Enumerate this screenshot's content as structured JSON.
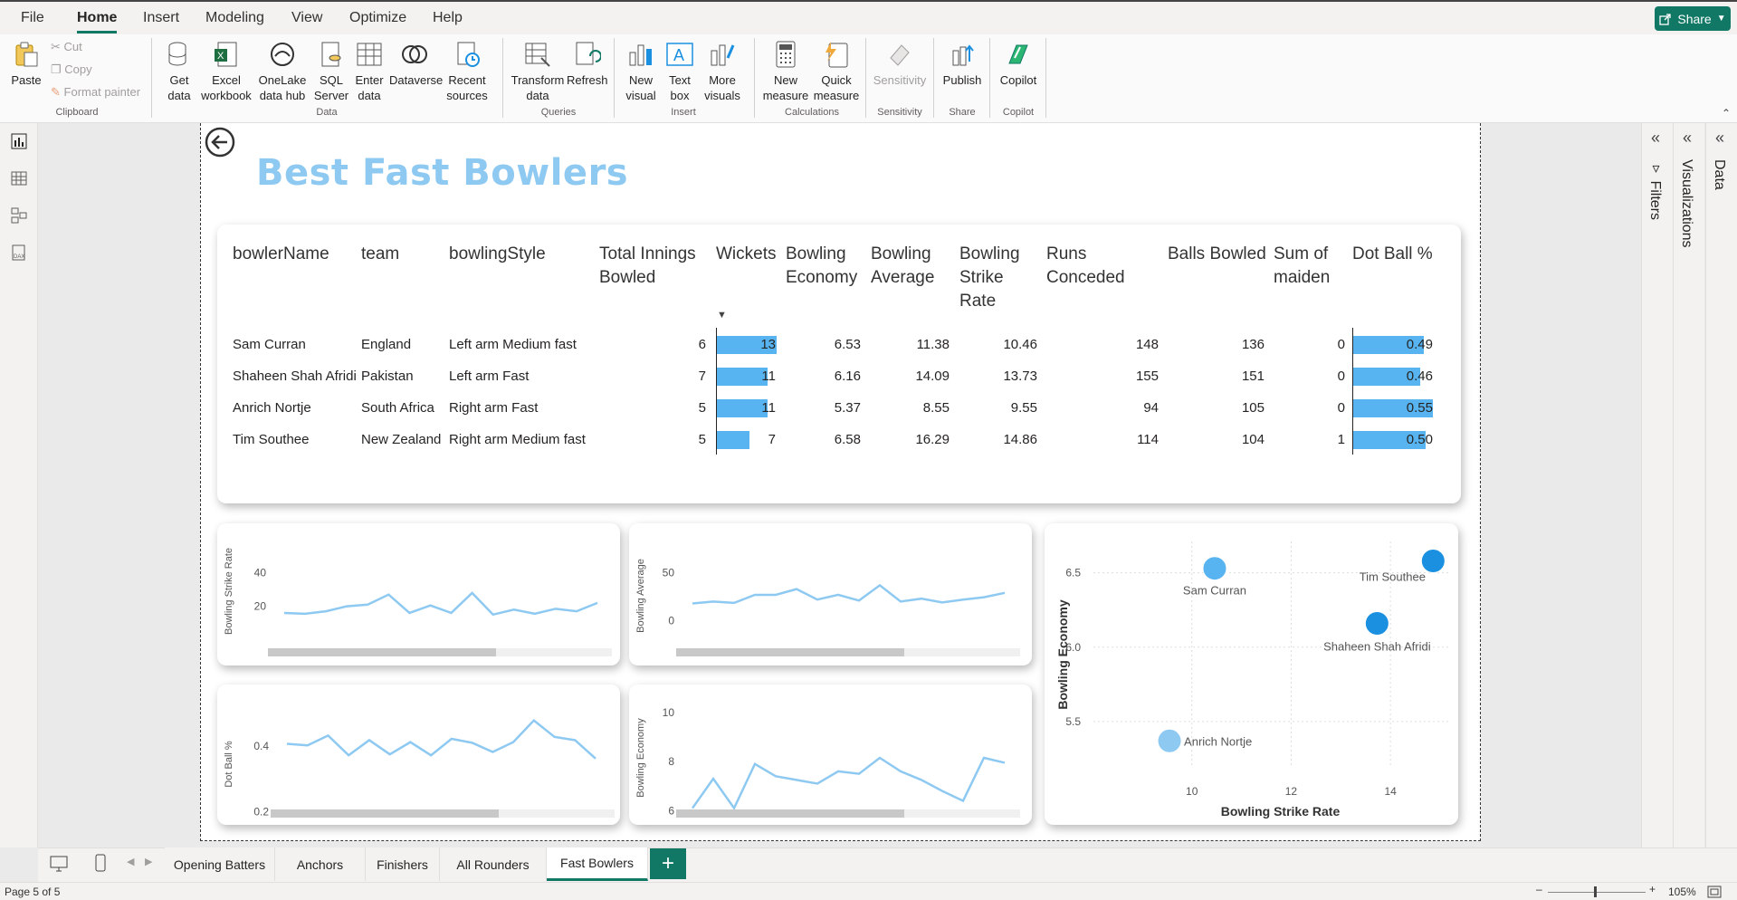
{
  "menu": {
    "items": [
      "File",
      "Home",
      "Insert",
      "Modeling",
      "View",
      "Optimize",
      "Help"
    ],
    "active": "Home",
    "share": "Share"
  },
  "ribbon": {
    "paste": "Paste",
    "cut": "Cut",
    "copy": "Copy",
    "format_painter": "Format painter",
    "get_data": "Get data",
    "excel": "Excel workbook",
    "onelake": "OneLake data hub",
    "sql": "SQL Server",
    "enter_data": "Enter data",
    "dataverse": "Dataverse",
    "recent": "Recent sources",
    "transform": "Transform data",
    "refresh": "Refresh",
    "new_visual": "New visual",
    "text_box": "Text box",
    "more_visuals": "More visuals",
    "new_measure": "New measure",
    "quick_measure": "Quick measure",
    "sensitivity": "Sensitivity",
    "publish": "Publish",
    "copilot": "Copilot",
    "groups": {
      "clipboard": "Clipboard",
      "data": "Data",
      "queries": "Queries",
      "insert": "Insert",
      "calculations": "Calculations",
      "sensitivity": "Sensitivity",
      "share": "Share",
      "copilot": "Copilot"
    }
  },
  "report": {
    "title": "Best Fast Bowlers",
    "table": {
      "columns": [
        "bowlerName",
        "team",
        "bowlingStyle",
        "Total Innings Bowled",
        "Wickets",
        "Bowling Economy",
        "Bowling Average",
        "Bowling Strike Rate",
        "Runs Conceded",
        "Balls Bowled",
        "Sum of maiden",
        "Dot Ball %"
      ],
      "rows": [
        {
          "name": "Sam Curran",
          "team": "England",
          "style": "Left arm Medium fast",
          "innings": "6",
          "wickets": "13",
          "economy": "6.53",
          "average": "11.38",
          "strike": "10.46",
          "runs": "148",
          "balls": "136",
          "maiden": "0",
          "dot": "0.49"
        },
        {
          "name": "Shaheen Shah Afridi",
          "team": "Pakistan",
          "style": "Left arm Fast",
          "innings": "7",
          "wickets": "11",
          "economy": "6.16",
          "average": "14.09",
          "strike": "13.73",
          "runs": "155",
          "balls": "151",
          "maiden": "0",
          "dot": "0.46"
        },
        {
          "name": "Anrich Nortje",
          "team": "South Africa",
          "style": "Right arm Fast",
          "innings": "5",
          "wickets": "11",
          "economy": "5.37",
          "average": "8.55",
          "strike": "9.55",
          "runs": "94",
          "balls": "105",
          "maiden": "0",
          "dot": "0.55"
        },
        {
          "name": "Tim Southee",
          "team": "New Zealand",
          "style": "Right arm Medium fast",
          "innings": "5",
          "wickets": "7",
          "economy": "6.58",
          "average": "16.29",
          "strike": "14.86",
          "runs": "114",
          "balls": "104",
          "maiden": "1",
          "dot": "0.50"
        }
      ]
    }
  },
  "chart_data": [
    {
      "type": "line",
      "ylabel": "Bowling Strike Rate",
      "yticks": [
        20,
        40
      ],
      "ylim": [
        10,
        48
      ],
      "series": [
        {
          "values": [
            16,
            15.5,
            17,
            20,
            21,
            27,
            16,
            20.5,
            16,
            28,
            15,
            18,
            15.5,
            18.5,
            17,
            22
          ]
        }
      ]
    },
    {
      "type": "line",
      "ylabel": "Bowling Average",
      "yticks": [
        0,
        50
      ],
      "ylim": [
        -10,
        62
      ],
      "series": [
        {
          "values": [
            18,
            20,
            18.5,
            27,
            27,
            33,
            22,
            27,
            21,
            37,
            20,
            23,
            19,
            22,
            24.5,
            29
          ]
        }
      ]
    },
    {
      "type": "line",
      "ylabel": "Dot Ball %",
      "yticks": [
        0.2,
        0.4
      ],
      "ylim": [
        0.18,
        0.51
      ],
      "series": [
        {
          "values": [
            0.407,
            0.402,
            0.432,
            0.372,
            0.418,
            0.375,
            0.412,
            0.372,
            0.422,
            0.41,
            0.382,
            0.412,
            0.478,
            0.428,
            0.418,
            0.362
          ]
        }
      ]
    },
    {
      "type": "line",
      "ylabel": "Bowling Economy",
      "yticks": [
        6,
        8,
        10
      ],
      "ylim": [
        5.9,
        10.4
      ],
      "series": [
        {
          "values": [
            6.1,
            7.3,
            6.1,
            7.9,
            7.4,
            7.25,
            7.1,
            7.6,
            7.5,
            8.15,
            7.6,
            7.25,
            6.8,
            6.4,
            8.15,
            7.95
          ]
        }
      ]
    },
    {
      "type": "scatter",
      "xlabel": "Bowling Strike Rate",
      "ylabel": "Bowling Economy",
      "xticks": [
        10,
        12,
        14
      ],
      "yticks": [
        5.5,
        6.0,
        6.5
      ],
      "xlim": [
        8.2,
        15
      ],
      "ylim": [
        5.25,
        6.65
      ],
      "points": [
        {
          "label": "Sam Curran",
          "x": 10.46,
          "y": 6.53,
          "color": "#57b4f1"
        },
        {
          "label": "Tim Southee",
          "x": 14.86,
          "y": 6.58,
          "color": "#1b90e0"
        },
        {
          "label": "Shaheen Shah Afridi",
          "x": 13.73,
          "y": 6.16,
          "color": "#1b90e0"
        },
        {
          "label": "Anrich Nortje",
          "x": 9.55,
          "y": 5.37,
          "color": "#8ec9f2"
        }
      ]
    }
  ],
  "panes": {
    "filters": "Filters",
    "visualizations": "Visualizations",
    "data": "Data"
  },
  "tabs": [
    "Opening Batters",
    "Anchors",
    "Finishers",
    "All Rounders",
    "Fast Bowlers"
  ],
  "status": {
    "page": "Page 5 of 5",
    "zoom": "105%"
  },
  "colors": {
    "accent": "#117865",
    "bar": "#57b4f1",
    "line": "#8ec9f2",
    "title": "#8ec9f2"
  }
}
